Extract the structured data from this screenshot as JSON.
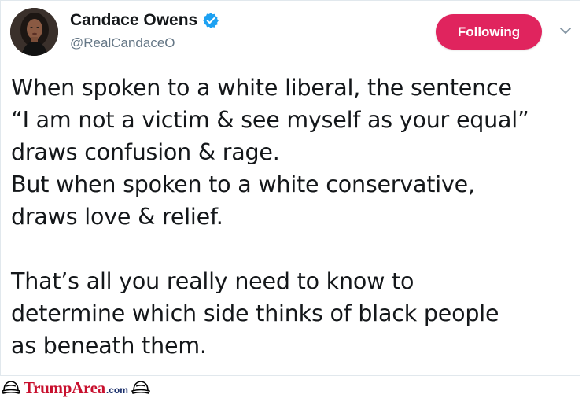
{
  "tweet": {
    "author": {
      "name": "Candace Owens",
      "handle": "@RealCandaceO",
      "avatar": "profile-photo",
      "verified_icon": "verified-badge-icon"
    },
    "follow_button": {
      "label": "Following",
      "color": "#e0245e"
    },
    "menu_icon": "chevron-down-icon",
    "text_lines": [
      "When spoken to a white liberal, the sentence",
      "“I am not a victim & see myself as your equal”",
      "draws confusion & rage.",
      "But when spoken to a white conservative,",
      "draws love & relief.",
      "",
      "That’s all you really need to know to",
      "determine which side thinks of black people",
      "as beneath them."
    ]
  },
  "watermark": {
    "brand": "TrumpArea",
    "suffix": ".com",
    "brand_color": "#c8102e",
    "icon": "trump-hat-icon"
  },
  "colors": {
    "text": "#14171a",
    "secondary": "#657786",
    "verified": "#1da1f2",
    "border": "#e1e8ed"
  }
}
